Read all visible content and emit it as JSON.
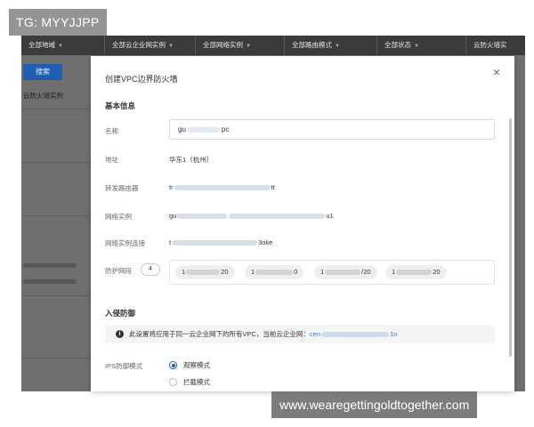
{
  "filters": [
    {
      "label": "全部地域"
    },
    {
      "label": "全部云企业网实例"
    },
    {
      "label": "全部网络实例"
    },
    {
      "label": "全部路由模式"
    },
    {
      "label": "全部状态"
    },
    {
      "label": "云防火墙实"
    }
  ],
  "background": {
    "search_button": "搜索",
    "column_header": "云防火墙实例"
  },
  "watermarks": {
    "top": "TG: MYYJJPP",
    "bottom": "www.wearegettingoldtogether.com"
  },
  "dialog": {
    "title": "创建VPC边界防火墙",
    "close_glyph": "×",
    "basic_info": {
      "section_title": "基本信息",
      "name_label": "名称",
      "name_value_start": "gu",
      "name_value_end": "pc",
      "address_label": "地址",
      "address_value": "华东1（杭州）",
      "router_label": "转发路由器",
      "router_value_start": "tr",
      "router_value_end": "tt",
      "network_instance_label": "网络实例",
      "network_instance_start": "gu",
      "network_instance_end": "u1",
      "network_connection_label": "网络实例连接",
      "network_connection_start": "t",
      "network_connection_end": "3oke",
      "protected_segments_label": "防护网段",
      "protected_segments_count": "4",
      "segments": [
        {
          "start": "1",
          "end": "20"
        },
        {
          "start": "1",
          "end": "0"
        },
        {
          "start": "1",
          "end": "/20"
        },
        {
          "start": "1",
          "end": "20"
        }
      ]
    },
    "intrusion": {
      "section_title": "入侵防御",
      "notice_icon": "i",
      "notice_text": "此设置将应用于同一云企业网下的所有VPC，当前云企业网：",
      "notice_link_start": "cen",
      "notice_link_end": "1o",
      "ips_mode_label": "IPS防御模式",
      "options": [
        {
          "label": "观察模式",
          "selected": true
        },
        {
          "label": "拦截模式",
          "selected": false
        }
      ]
    }
  },
  "colors": {
    "accent": "#1f5fae",
    "link": "#3a79c6",
    "filter_bar": "#3b3b3b",
    "overlay": "#6f6f6f"
  }
}
